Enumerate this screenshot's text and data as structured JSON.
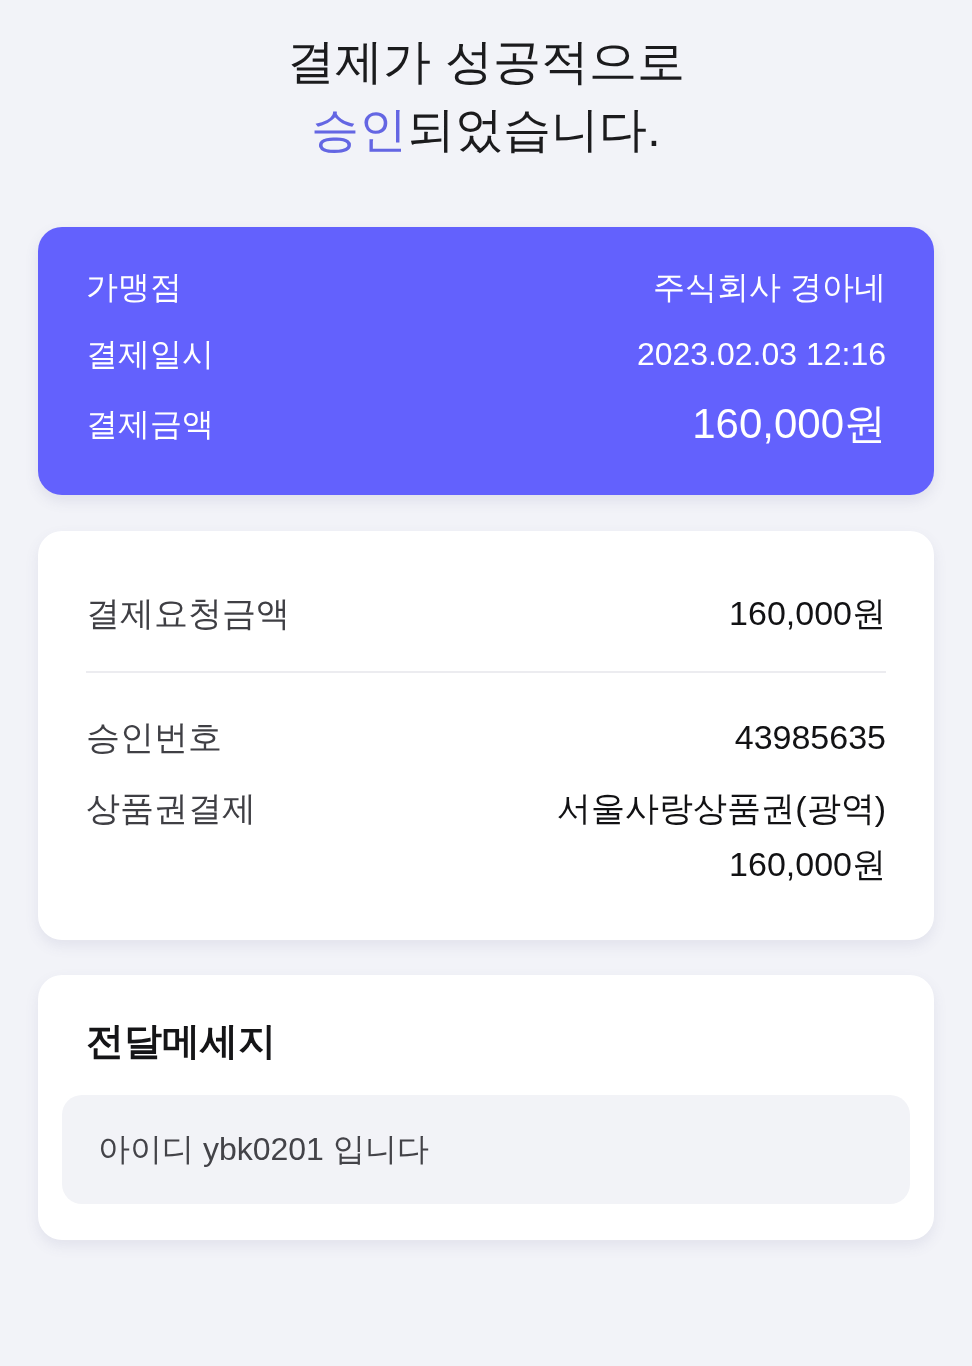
{
  "title": {
    "lines": [
      [
        {
          "text": "결제가 성공적으로",
          "accent": false
        }
      ],
      [
        {
          "text": "승인",
          "accent": true
        },
        {
          "text": "되었습니다.",
          "accent": false
        }
      ]
    ]
  },
  "summary": {
    "rows": [
      {
        "label": "가맹점",
        "value": "주식회사 경아네",
        "emphasis": false
      },
      {
        "label": "결제일시",
        "value": "2023.02.03 12:16",
        "emphasis": false
      },
      {
        "label": "결제금액",
        "value": "160,000원",
        "emphasis": true
      }
    ]
  },
  "details": {
    "sections": [
      {
        "rows": [
          {
            "label": "결제요청금액",
            "value_lines": [
              "160,000원"
            ]
          }
        ]
      },
      {
        "rows": [
          {
            "label": "승인번호",
            "value_lines": [
              "43985635"
            ]
          },
          {
            "label": "상품권결제",
            "value_lines": [
              "서울사랑상품권(광역)",
              "160,000원"
            ]
          }
        ]
      }
    ]
  },
  "message": {
    "title": "전달메세지",
    "text": "아이디 ybk0201 입니다"
  }
}
